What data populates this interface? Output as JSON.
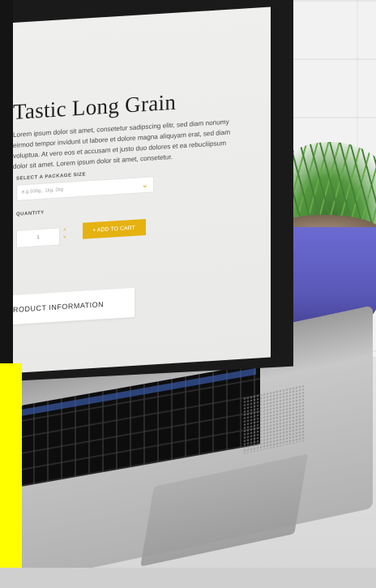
{
  "product": {
    "title": "Tastic Long Grain",
    "description": "Lorem ipsum dolor sit amet, consetetur sadipscing elitr, sed diam nonumy eirmod tempor invidunt ut labore et dolore magna aliquyam erat, sed diam voluptua. At vero eos et accusam et justo duo dolores et ea rebucliipsum dolor sit amet. Lorem ipsum dolor sit amet, consetetur.",
    "package_label": "SELECT A PACKAGE SIZE",
    "package_placeholder": "e.g 500g , 1kg, 2kg",
    "quantity_label": "QUANTITY",
    "quantity_value": "1",
    "add_to_cart": "+ ADD TO CART",
    "info_label": "RODUCT INFORMATION"
  },
  "colors": {
    "accent": "#e5b210",
    "overlay_yellow": "#ffff00",
    "pot": "#5a58b7"
  }
}
